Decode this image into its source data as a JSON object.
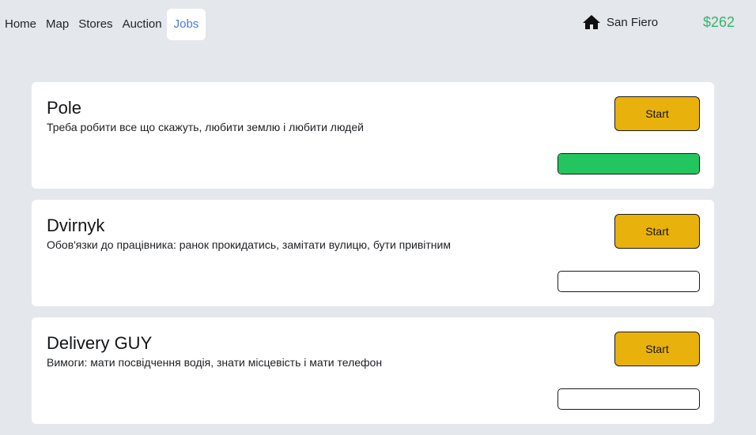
{
  "nav": {
    "items": [
      {
        "label": "Home",
        "active": false
      },
      {
        "label": "Map",
        "active": false
      },
      {
        "label": "Stores",
        "active": false
      },
      {
        "label": "Auction",
        "active": false
      },
      {
        "label": "Jobs",
        "active": true
      }
    ]
  },
  "status": {
    "home_icon": "house-icon",
    "city": "San Fiero",
    "money": "$262"
  },
  "colors": {
    "background": "#e4e7eb",
    "active_nav": "#4a79d8",
    "money": "#34b36a",
    "start_button": "#e8b10b",
    "progress_fill": "#22c55e"
  },
  "jobs": [
    {
      "title": "Pole",
      "description": "Треба робити все що скажуть, любити землю і любити людей",
      "button_label": "Start",
      "progress": 1
    },
    {
      "title": "Dvirnyk",
      "description": "Обов'язки до працівника: ранок прокидатись, замітати вулицю, бути привітним",
      "button_label": "Start",
      "progress": 0
    },
    {
      "title": "Delivery GUY",
      "description": "Вимоги: мати посвідчення водія, знати місцевість і мати телефон",
      "button_label": "Start",
      "progress": 0
    }
  ]
}
